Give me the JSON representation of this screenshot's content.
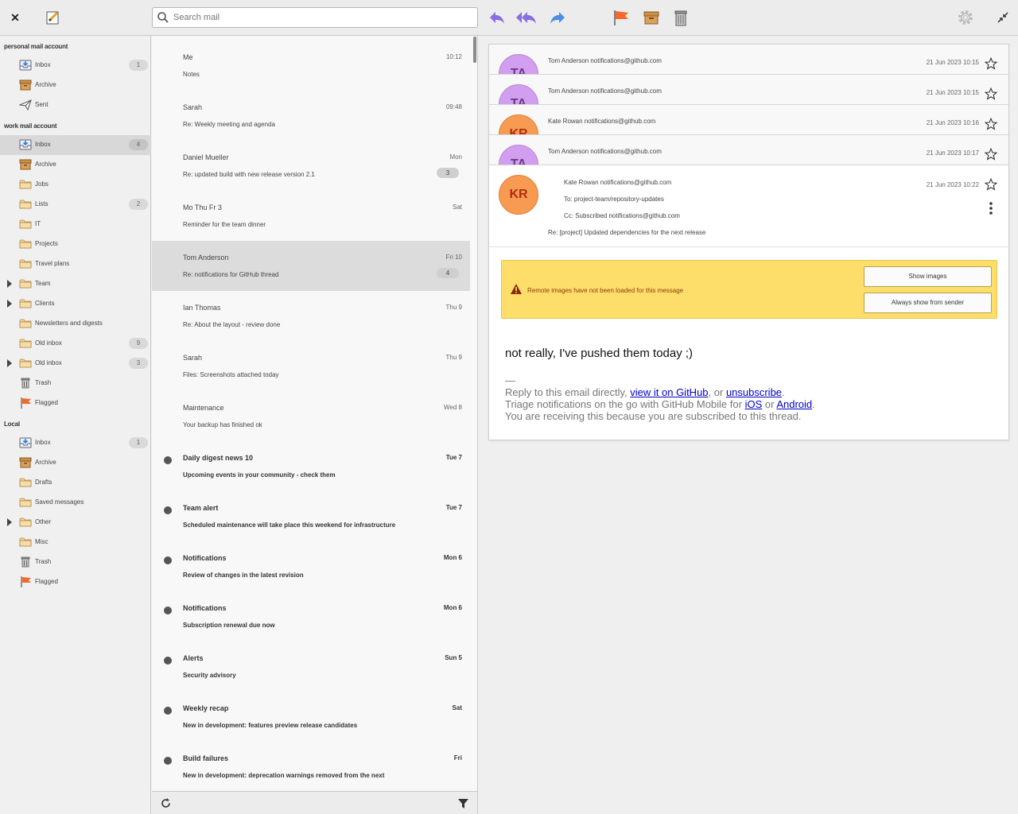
{
  "toolbar": {
    "search_placeholder": "Search mail",
    "icons": [
      "close-icon",
      "compose-icon",
      "search-icon",
      "reply-icon",
      "reply-all-icon",
      "forward-icon",
      "flag-icon",
      "archive-icon",
      "trash-icon",
      "gear-icon",
      "collapse-icon"
    ]
  },
  "sidebar": {
    "accounts": [
      {
        "name": "personal mail account",
        "folders": [
          {
            "name": "Inbox",
            "count": "1"
          },
          {
            "name": "Archive"
          },
          {
            "name": "Sent"
          }
        ]
      },
      {
        "name": "work mail account",
        "folders": [
          {
            "name": "Inbox",
            "count": "4"
          },
          {
            "name": "Archive"
          },
          {
            "name": "Jobs"
          },
          {
            "name": "Lists",
            "count": "2"
          },
          {
            "name": "IT"
          },
          {
            "name": "Projects"
          },
          {
            "name": "Travel plans"
          },
          {
            "name": "Team"
          },
          {
            "name": "Clients"
          },
          {
            "name": "Newsletters and digests"
          },
          {
            "name": "Old inbox",
            "count": "9"
          },
          {
            "name": "Old inbox",
            "count": "3"
          },
          {
            "name": "Trash"
          },
          {
            "name": "Flagged"
          }
        ]
      },
      {
        "name": "Local",
        "folders": [
          {
            "name": "Inbox",
            "count": "1"
          },
          {
            "name": "Archive"
          },
          {
            "name": "Drafts"
          },
          {
            "name": "Saved messages"
          },
          {
            "name": "Other"
          },
          {
            "name": "Misc"
          },
          {
            "name": "Trash"
          },
          {
            "name": "Flagged"
          }
        ]
      }
    ]
  },
  "messages": [
    {
      "sender": "Me",
      "date": "10:12",
      "subject": "Notes",
      "unread": false
    },
    {
      "sender": "Sarah",
      "date": "09:48",
      "subject": "Re: Weekly meeting and agenda",
      "unread": false
    },
    {
      "sender": "Daniel Mueller",
      "date": "Mon",
      "subject": "Re: updated build with new release version 2.1",
      "badge": "3",
      "unread": false
    },
    {
      "sender": "Mo Thu Fr 3",
      "date": "Sat",
      "subject": "Reminder for the team dinner",
      "unread": false
    },
    {
      "sender": "Tom Anderson",
      "date": "Fri 10",
      "subject": "Re: notifications for GitHub thread",
      "badge": "4",
      "unread": false
    },
    {
      "sender": "Ian Thomas",
      "date": "Thu 9",
      "subject": "Re: About the layout - review done",
      "unread": false
    },
    {
      "sender": "Sarah",
      "date": "Thu 9",
      "subject": "Files: Screenshots attached today",
      "unread": false
    },
    {
      "sender": "Maintenance",
      "date": "Wed 8",
      "subject": "Your backup has finished ok",
      "unread": false
    },
    {
      "sender": "Daily digest news 10",
      "date": "Tue 7",
      "subject": "Upcoming events in your community - check them",
      "unread": true
    },
    {
      "sender": "Team alert",
      "date": "Tue 7",
      "subject": "Scheduled maintenance will take place this weekend for infrastructure",
      "unread": true
    },
    {
      "sender": "Notifications",
      "date": "Mon 6",
      "subject": "Review of changes in the latest revision",
      "unread": true
    },
    {
      "sender": "Notifications",
      "date": "Mon 6",
      "subject": "Subscription renewal due now",
      "unread": true
    },
    {
      "sender": "Alerts",
      "date": "Sun 5",
      "subject": "Security advisory",
      "unread": true
    },
    {
      "sender": "Weekly recap",
      "date": "Sat",
      "subject": "New in development: features preview release candidates",
      "unread": true
    },
    {
      "sender": "Build failures",
      "date": "Fri",
      "subject": "New in development: deprecation warnings removed from the next",
      "unread": true
    }
  ],
  "reader": {
    "conversation": [
      {
        "from": "Tom Anderson notifications@github.com",
        "date": "21 Jun 2023 10:15",
        "avatar": "purple",
        "initials": "TA"
      },
      {
        "from": "Tom Anderson notifications@github.com",
        "date": "21 Jun 2023 10:15",
        "avatar": "purple",
        "initials": "TA"
      },
      {
        "from": "Kate Rowan notifications@github.com",
        "date": "21 Jun 2023 10:16",
        "avatar": "orange",
        "initials": "KR"
      },
      {
        "from": "Tom Anderson notifications@github.com",
        "date": "21 Jun 2023 10:17",
        "avatar": "purple",
        "initials": "TA"
      }
    ],
    "open": {
      "initials": "KR",
      "from": "Kate Rowan notifications@github.com",
      "to": "To: project-team/repository-updates",
      "cc": "Cc: Subscribed notifications@github.com",
      "subject": "Re: [project] Updated dependencies for the next release",
      "date": "21 Jun 2023 10:22"
    },
    "remote_warning": "Remote images have not been loaded for this message",
    "show_images": "Show images",
    "always_show": "Always show from sender",
    "body": "not really, I've pushed them today ;)",
    "sig_dash": "—",
    "sig_reply_prefix": "Reply to this email directly, ",
    "sig_view_link": "view it on GitHub",
    "sig_or": ", or ",
    "sig_unsub_link": "unsubscribe",
    "sig_period": ".",
    "sig_triage_prefix": "Triage notifications on the go with GitHub Mobile for ",
    "sig_ios": "iOS",
    "sig_or2": " or ",
    "sig_android": "Android",
    "sig_period2": ".",
    "sig_receiving": "You are receiving this because you are subscribed to this thread."
  },
  "colors": {
    "flag": "#f36a2a",
    "avatar_purple": "#d29ef0",
    "avatar_orange": "#f79a52",
    "warning_bar": "#fdde6a",
    "link": "#0000c8"
  }
}
